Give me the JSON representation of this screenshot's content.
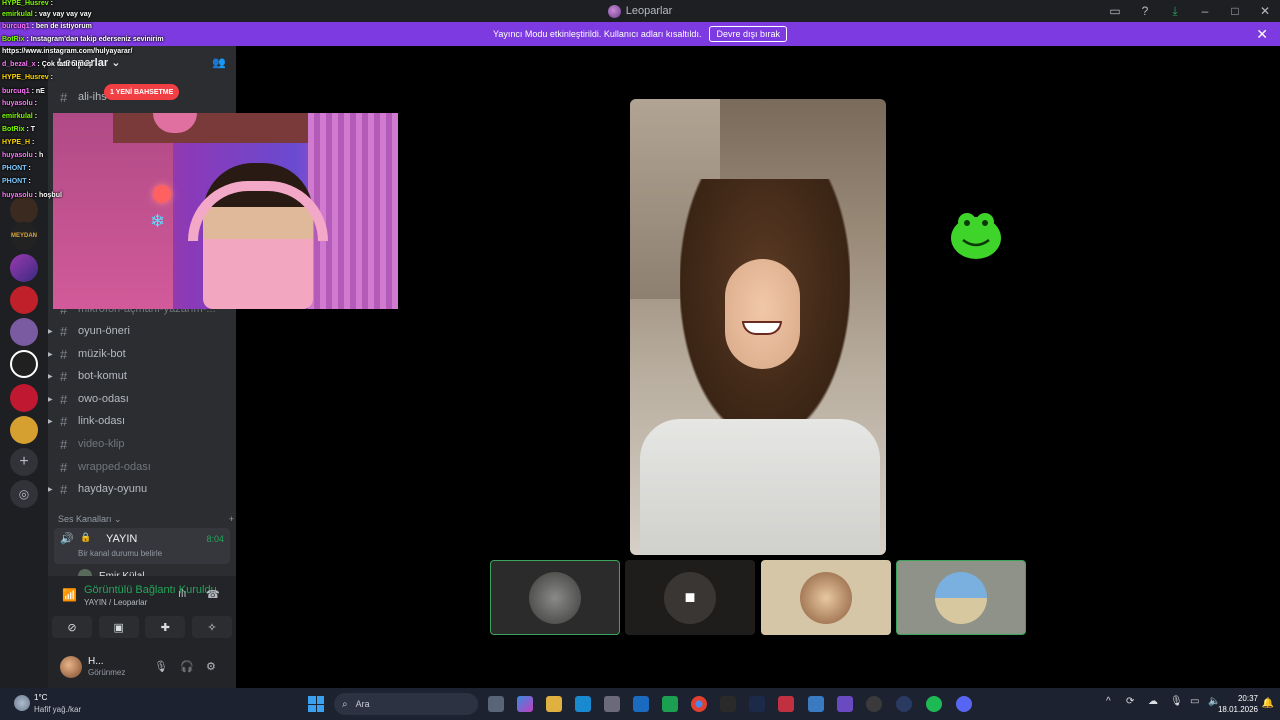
{
  "window": {
    "title": "Leoparlar"
  },
  "streamer_bar": {
    "text": "Yayıncı Modu etkinleştirildi. Kullanıcı adları kısaltıldı.",
    "button": "Devre dışı bırak"
  },
  "server": {
    "name": "Leoparlar"
  },
  "mention_pill": "1 YENİ BAHSETME",
  "channels": [
    {
      "name": "ali-ihs",
      "muted": false
    },
    {
      "name": "mikrofon-açmanı-yazarım-...",
      "muted": true
    },
    {
      "name": "oyun-öneri",
      "muted": false
    },
    {
      "name": "müzik-bot",
      "muted": false
    },
    {
      "name": "bot-komut",
      "muted": false
    },
    {
      "name": "owo-odası",
      "muted": false
    },
    {
      "name": "link-odası",
      "muted": false
    },
    {
      "name": "video-klip",
      "muted": true
    },
    {
      "name": "wrapped-odası",
      "muted": true
    },
    {
      "name": "hayday-oyunu",
      "muted": false
    }
  ],
  "voice": {
    "category": "Ses Kanalları",
    "channel": "YAYIN",
    "time": "8:04",
    "status": "Bir kanal durumu belirle",
    "user": "Emir Külal"
  },
  "rtc": {
    "connected": "Görüntülü Bağlantı Kuruldu",
    "sub": "YAYIN / Leoparlar"
  },
  "user": {
    "name": "H...",
    "status": "Görünmez"
  },
  "guild_labels": {
    "meydan": "MEYDAN"
  },
  "chat": [
    {
      "user": "HYPE_Husrev",
      "msg": "",
      "color": "#7cfc00"
    },
    {
      "user": "emirkulal",
      "msg": "vay vay vay vay",
      "color": "#7cfc00"
    },
    {
      "user": "burcuq1",
      "msg": "ben de istiyorum",
      "color": "#ff77ff"
    },
    {
      "user": "BotRix",
      "msg": "Instagram'dan takip ederseniz sevinirim",
      "color": "#7cfc00"
    },
    {
      "user": "",
      "msg": "https://www.instagram.com/hulyayarar/",
      "color": "#ffffff"
    },
    {
      "user": "d_bezal_x",
      "msg": "Çok tatlı olmuş",
      "color": "#ff77ff"
    },
    {
      "user": "HYPE_Husrev",
      "msg": "",
      "color": "#ffd700"
    },
    {
      "user": "burcuq1",
      "msg": "nE",
      "color": "#ff77ff"
    },
    {
      "user": "huyasolu",
      "msg": "",
      "color": "#ff77ff"
    },
    {
      "user": "emirkulal",
      "msg": "",
      "color": "#7cfc00"
    },
    {
      "user": "BotRix",
      "msg": "T",
      "color": "#7cfc00"
    },
    {
      "user": "HYPE_H",
      "msg": "",
      "color": "#ffd700"
    },
    {
      "user": "huyasolu",
      "msg": "h",
      "color": "#ff77ff"
    },
    {
      "user": "PHONT",
      "msg": "",
      "color": "#7fc8ff"
    },
    {
      "user": "PHONT",
      "msg": "",
      "color": "#7fc8ff"
    },
    {
      "user": "huyasolu",
      "msg": "hoşbul",
      "color": "#ff77ff"
    }
  ],
  "taskbar": {
    "temp": "1°C",
    "cond": "Hafif yağ./kar",
    "search": "Ara",
    "time": "20:37",
    "date": "18.01.2026"
  },
  "colors": {
    "accent": "#7c3ae0",
    "green": "#23a559",
    "danger": "#f23f43"
  }
}
